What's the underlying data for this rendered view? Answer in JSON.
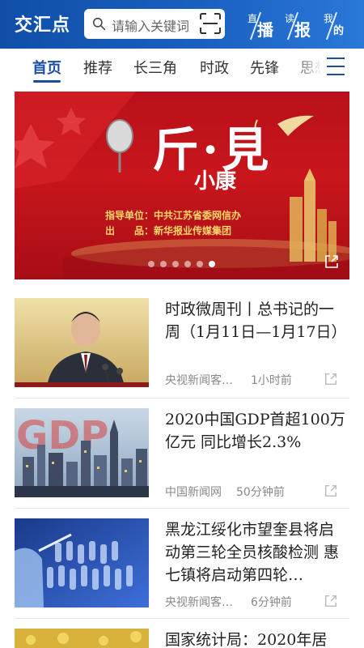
{
  "header": {
    "logo": "交汇点",
    "search_placeholder": "请输入关键词",
    "buttons": [
      {
        "small": "直",
        "big": "播"
      },
      {
        "small": "读",
        "big": "报"
      },
      {
        "small": "我",
        "big": "的"
      }
    ]
  },
  "tabs": [
    "首页",
    "推荐",
    "长三角",
    "时政",
    "先锋",
    "思想"
  ],
  "active_tab": "首页",
  "banner": {
    "title": "斤·見",
    "subtitle": "小康",
    "guide_line": "指导单位：中共江苏省委网信办",
    "publisher_line": "出　　品：新华报业传媒集团",
    "slide_count": 6,
    "active_slide": 6
  },
  "news": [
    {
      "title": "时政微周刊丨总书记的一周（1月11日—1月17日）",
      "source": "央视新闻客…",
      "time": "1小时前",
      "thumb": "portrait-photo"
    },
    {
      "title": "2020中国GDP首超100万亿元 同比增长2.3%",
      "source": "中国新闻网",
      "time": "50分钟前",
      "thumb": "gdp-city-skyline"
    },
    {
      "title": "黑龙江绥化市望奎县将启动第三轮全员核酸检测 惠七镇将启动第四轮…",
      "source": "央视新闻客…",
      "time": "6分钟前",
      "thumb": "lab-test-tubes"
    },
    {
      "title": "国家统计局：2020年居",
      "source": "",
      "time": "",
      "thumb": "grain-photo"
    }
  ],
  "colors": {
    "header_blue": "#1a5cb8",
    "active_tab": "#1a4ea0",
    "banner_red": "#c8161c"
  }
}
